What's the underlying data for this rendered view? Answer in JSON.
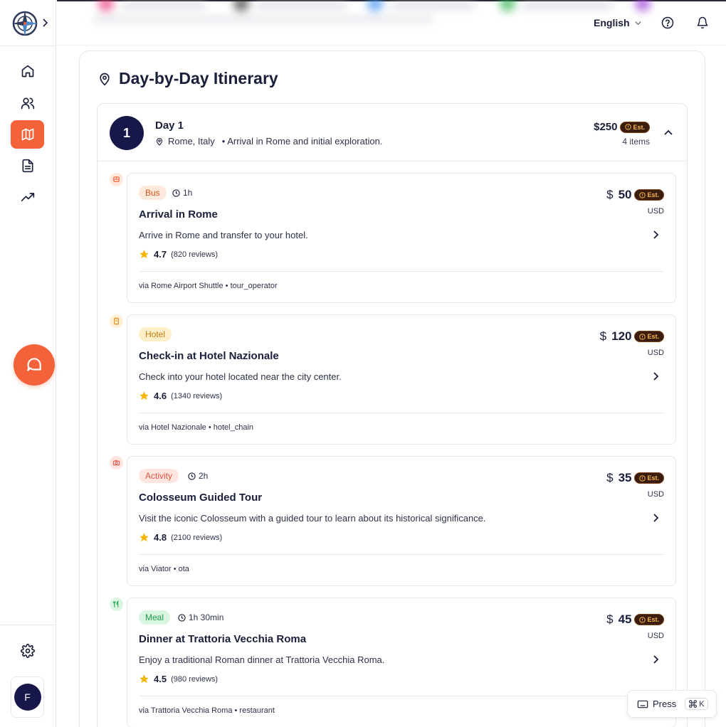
{
  "header": {
    "language": "English"
  },
  "itinerary": {
    "title": "Day-by-Day Itinerary",
    "day": {
      "number": "1",
      "label": "Day 1",
      "location": "Rome, Italy",
      "summary": "• Arrival in Rome and initial exploration.",
      "price": "$250",
      "items_count": "4 items"
    },
    "est_label": "Est.",
    "items": [
      {
        "tag": "Bus",
        "duration": "1h",
        "title": "Arrival in Rome",
        "description": "Arrive in Rome and transfer to your hotel.",
        "rating": "4.7",
        "reviews": "(820 reviews)",
        "via": "via Rome Airport Shuttle • tour_operator",
        "currency": "$",
        "price": "50",
        "unit": "USD"
      },
      {
        "tag": "Hotel",
        "duration": "",
        "title": "Check-in at Hotel Nazionale",
        "description": "Check into your hotel located near the city center.",
        "rating": "4.6",
        "reviews": "(1340 reviews)",
        "via": "via Hotel Nazionale • hotel_chain",
        "currency": "$",
        "price": "120",
        "unit": "USD"
      },
      {
        "tag": "Activity",
        "duration": "2h",
        "title": "Colosseum Guided Tour",
        "description": "Visit the iconic Colosseum with a guided tour to learn about its historical significance.",
        "rating": "4.8",
        "reviews": "(2100 reviews)",
        "via": "via Viator • ota",
        "currency": "$",
        "price": "35",
        "unit": "USD"
      },
      {
        "tag": "Meal",
        "duration": "1h 30min",
        "title": "Dinner at Trattoria Vecchia Roma",
        "description": "Enjoy a traditional Roman dinner at Trattoria Vecchia Roma.",
        "rating": "4.5",
        "reviews": "(980 reviews)",
        "via": "via Trattoria Vecchia Roma • restaurant",
        "currency": "$",
        "price": "45",
        "unit": "USD"
      }
    ]
  },
  "user": {
    "initial": "F"
  },
  "shortcut": {
    "label": "Press",
    "key": "K"
  },
  "colors": {
    "accent": "#f4623a",
    "navy": "#17174a",
    "star": "#f5b301"
  },
  "icons": {
    "nav": [
      "home-icon",
      "users-icon",
      "map-icon",
      "document-icon",
      "trending-icon"
    ]
  }
}
